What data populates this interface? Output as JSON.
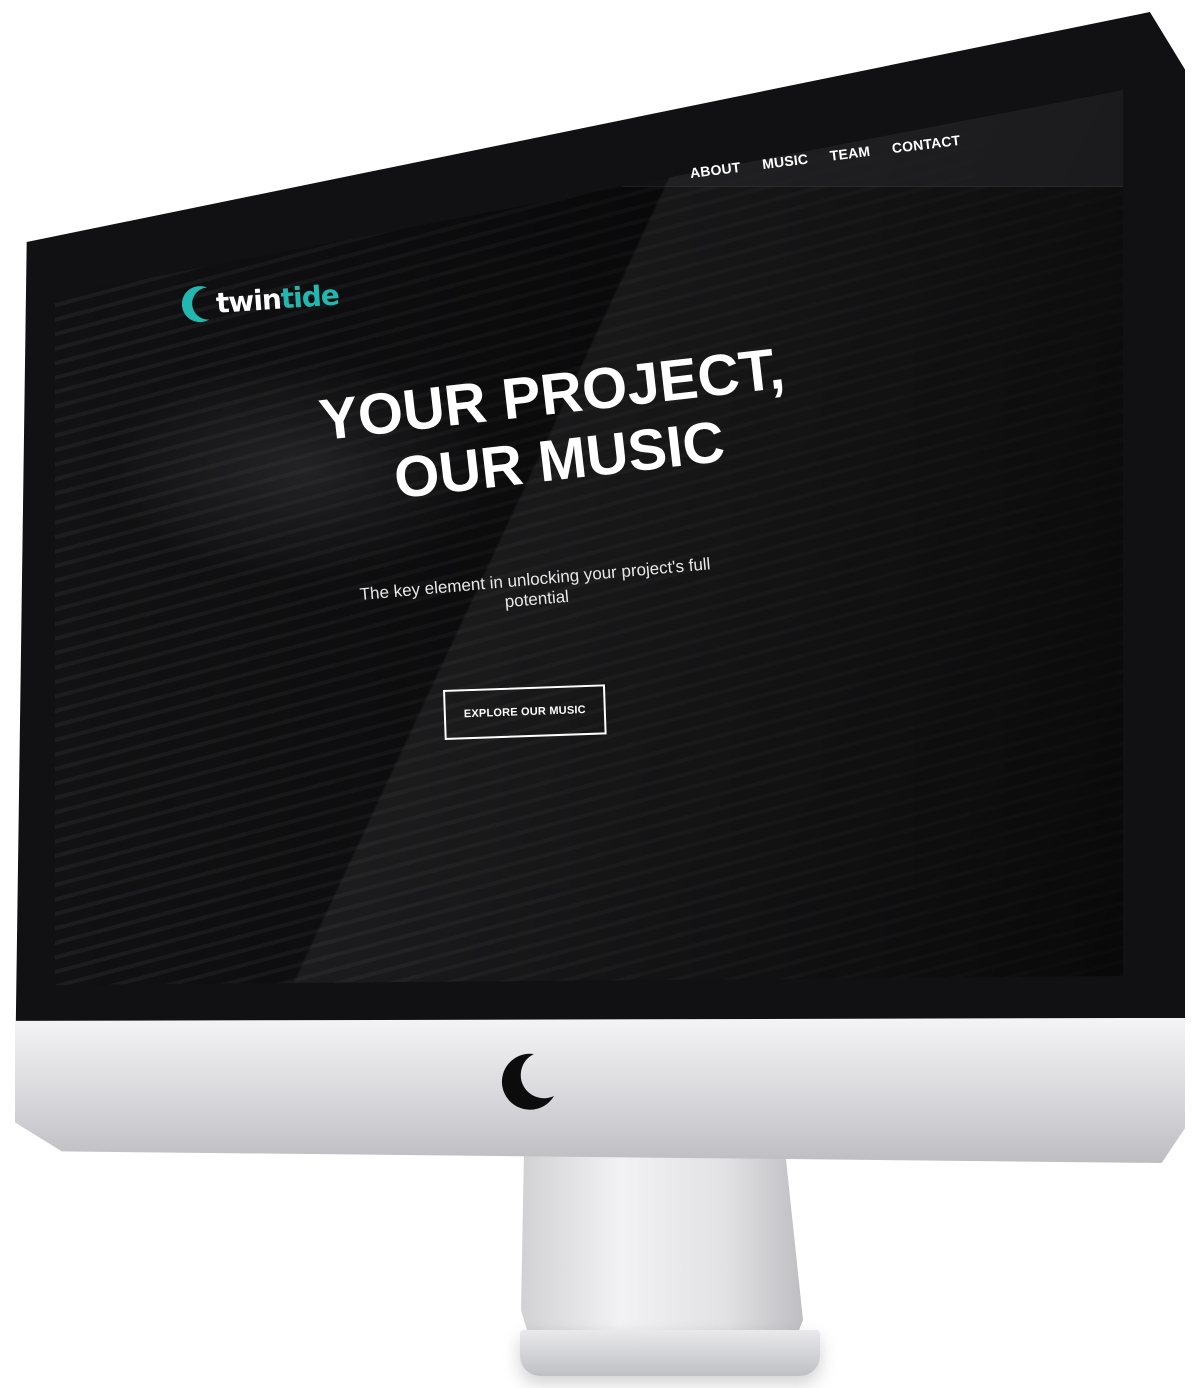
{
  "site": {
    "logo": {
      "word_a": "twin",
      "word_b": "tide",
      "accent": "#22b8b0",
      "icon": "wave-logo-icon"
    },
    "nav": [
      {
        "label": "ABOUT"
      },
      {
        "label": "MUSIC"
      },
      {
        "label": "TEAM"
      },
      {
        "label": "CONTACT"
      }
    ],
    "hero": {
      "headline": "YOUR PROJECT, OUR MUSIC",
      "subheadline": "The key element in unlocking your project's full potential",
      "cta_label": "EXPLORE OUR MUSIC"
    }
  },
  "device": {
    "type": "desktop-monitor",
    "logo_icon": "crescent-moon-icon"
  },
  "colors": {
    "background": "#070708",
    "text": "#ffffff",
    "accent": "#22b8b0"
  }
}
